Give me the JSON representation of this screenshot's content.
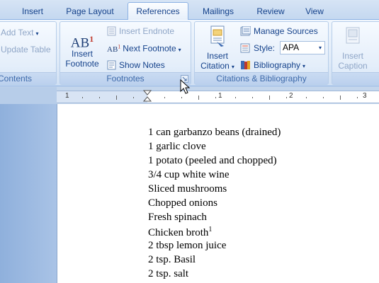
{
  "tabs": [
    {
      "label": "Insert"
    },
    {
      "label": "Page Layout"
    },
    {
      "label": "References"
    },
    {
      "label": "Mailings"
    },
    {
      "label": "Review"
    },
    {
      "label": "View"
    }
  ],
  "active_tab": "References",
  "ribbon": {
    "contents": {
      "add_text": "Add Text",
      "update_table": "Update Table",
      "label": "Contents"
    },
    "footnotes": {
      "insert_footnote_line1": "Insert",
      "insert_footnote_line2": "Footnote",
      "ab_icon_text": "AB",
      "ab_icon_sup": "1",
      "insert_endnote": "Insert Endnote",
      "next_footnote": "Next Footnote",
      "show_notes": "Show Notes",
      "label": "Footnotes"
    },
    "citations": {
      "insert_citation_line1": "Insert",
      "insert_citation_line2": "Citation",
      "manage_sources": "Manage Sources",
      "style_label": "Style:",
      "style_value": "APA",
      "bibliography": "Bibliography",
      "label": "Citations & Bibliography"
    },
    "captions": {
      "insert_caption_line1": "Insert",
      "insert_caption_line2": "Caption"
    }
  },
  "ruler": {
    "numbers": [
      "1",
      "1",
      "2",
      "3"
    ]
  },
  "document": {
    "lines": [
      "1 can garbanzo beans (drained)",
      "1 garlic clove",
      "1 potato (peeled and chopped)",
      "3/4 cup white wine",
      "Sliced mushrooms",
      "Chopped onions",
      "Fresh spinach",
      "Chicken broth",
      "2 tbsp lemon juice",
      "2 tsp. Basil",
      "2 tsp. salt"
    ],
    "footnote_ref": "1"
  },
  "colors": {
    "ribbon_text": "#15428b",
    "group_label": "#3e6aaa",
    "disabled_text": "#8fa6c7",
    "ribbon_border": "#8db2e3"
  }
}
